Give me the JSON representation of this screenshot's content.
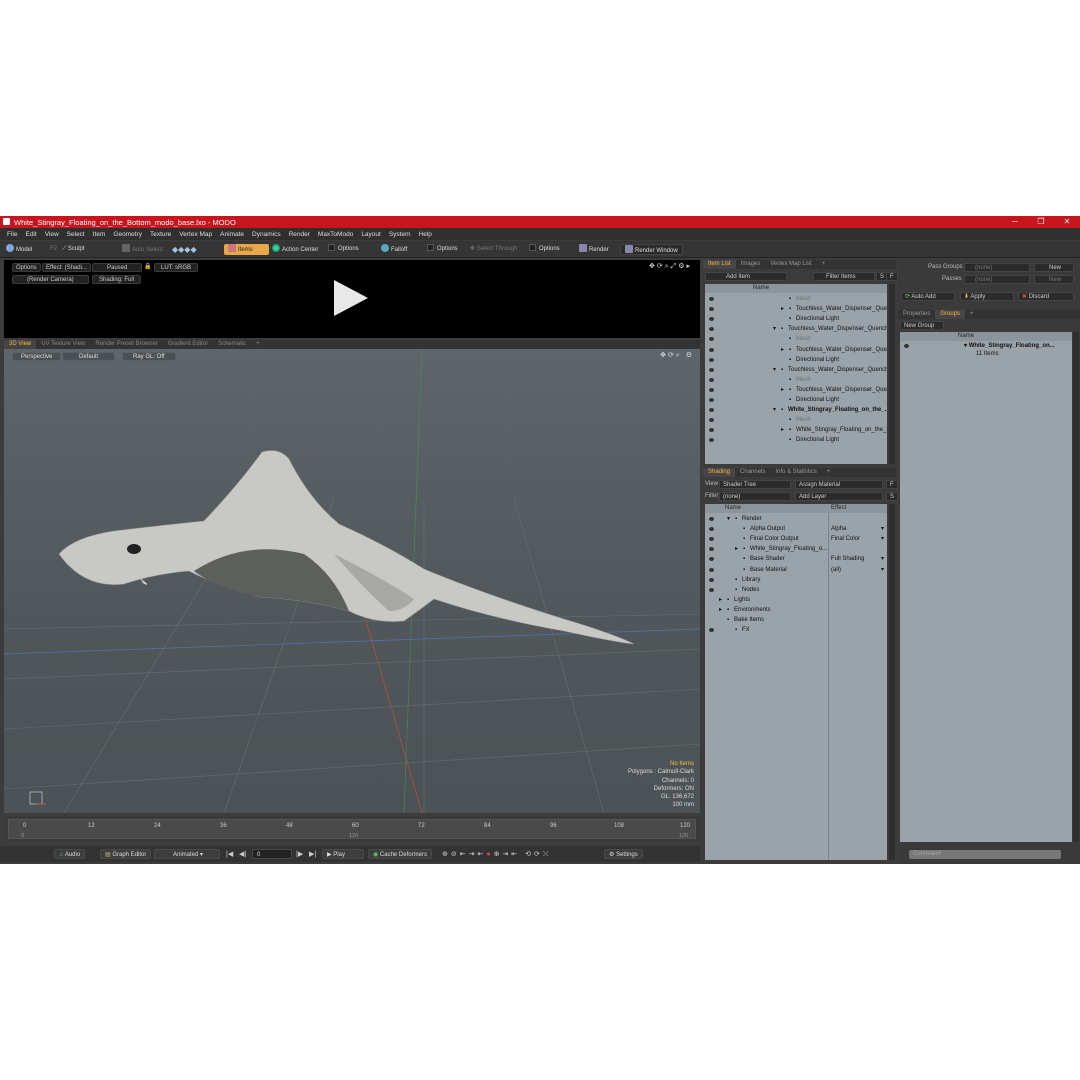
{
  "window": {
    "title": "White_Stingray_Floating_on_the_Bottom_modo_base.lxo - MODO",
    "min": "─",
    "max": "❐",
    "close": "✕"
  },
  "menu": [
    "File",
    "Edit",
    "View",
    "Select",
    "Item",
    "Geometry",
    "Texture",
    "Vertex Map",
    "Animate",
    "Dynamics",
    "Render",
    "MaxToModo",
    "Layout",
    "System",
    "Help"
  ],
  "toolbar": {
    "model": "Model",
    "model_key": "F2",
    "sculpt": "Sculpt",
    "auto_select": "Auto Select",
    "items": "Items",
    "action_center": "Action Center",
    "options1": "Options",
    "falloff": "Falloff",
    "options2": "Options",
    "select_through": "Select Through",
    "options3": "Options",
    "render": "Render",
    "render_window": "Render Window"
  },
  "render_view": {
    "options": "Options",
    "effect": "Effect: (Shadi...",
    "paused": "Paused",
    "lut": "LUT: sRGB",
    "camera": "(Render Camera)",
    "shading": "Shading: Full"
  },
  "viewport_tabs": [
    "3D View",
    "UV Texture View",
    "Render Preset Browser",
    "Gradient Editor",
    "Schematic",
    "+"
  ],
  "viewport": {
    "perspective": "Perspective",
    "default": "Default",
    "ray_gl": "Ray GL: Off"
  },
  "info": {
    "no_items": "No Items",
    "polygons": "Polygons : Catmull-Clark",
    "channels": "Channels: 0",
    "deformers": "Deformers: ON",
    "gl": "GL: 136,672",
    "scale": "100 mm"
  },
  "timeline": {
    "ticks": [
      "0",
      "12",
      "24",
      "36",
      "48",
      "60",
      "72",
      "84",
      "96",
      "108",
      "120"
    ],
    "sub": [
      "0",
      "120",
      "120"
    ]
  },
  "bottombar": {
    "audio": "Audio",
    "graph_editor": "Graph Editor",
    "animated": "Animated",
    "frame": "0",
    "play": "Play",
    "cache": "Cache Deformers",
    "settings": "Settings"
  },
  "item_panel": {
    "tabs": [
      "Item List",
      "Images",
      "Vertex Map List",
      "+"
    ],
    "add_item": "Add Item",
    "filter_items": "Filter Items",
    "s": "S",
    "f": "F",
    "col_name": "Name",
    "rows": [
      {
        "t": "Mesh",
        "lvl": 3,
        "gray": true
      },
      {
        "t": "Touchless_Water_Dispenser_Quench_...",
        "lvl": 3,
        "arrow": "▸"
      },
      {
        "t": "Directional Light",
        "lvl": 3
      },
      {
        "t": "Touchless_Water_Dispenser_Quench_Q8...",
        "lvl": 2,
        "arrow": "▾"
      },
      {
        "t": "Mesh",
        "lvl": 3,
        "gray": true
      },
      {
        "t": "Touchless_Water_Dispenser_Quench_...",
        "lvl": 3,
        "arrow": "▸"
      },
      {
        "t": "Directional Light",
        "lvl": 3
      },
      {
        "t": "Touchless_Water_Dispenser_Quench_Q8...",
        "lvl": 2,
        "arrow": "▾"
      },
      {
        "t": "Mesh",
        "lvl": 3,
        "gray": true
      },
      {
        "t": "Touchless_Water_Dispenser_Quench_...",
        "lvl": 3,
        "arrow": "▸"
      },
      {
        "t": "Directional Light",
        "lvl": 3
      },
      {
        "t": "White_Stingray_Floating_on_the_...",
        "lvl": 2,
        "arrow": "▾",
        "bold": true
      },
      {
        "t": "Mesh",
        "lvl": 3,
        "gray": true
      },
      {
        "t": "White_Stingray_Floating_on_the_Bott...",
        "lvl": 3,
        "arrow": "▸"
      },
      {
        "t": "Directional Light",
        "lvl": 3
      }
    ]
  },
  "shading_panel": {
    "tabs": [
      "Shading",
      "Channels",
      "Info & Statistics",
      "+"
    ],
    "view_label": "View",
    "view_value": "Shader Tree",
    "assign": "Assign Material",
    "filter_label": "Filter",
    "filter_value": "(none)",
    "add_layer": "Add Layer",
    "f": "F",
    "s": "S",
    "col_name": "Name",
    "col_effect": "Effect",
    "rows": [
      {
        "t": "Render",
        "lvl": 1,
        "arrow": "▾",
        "eff": ""
      },
      {
        "t": "Alpha Output",
        "lvl": 2,
        "eff": "Alpha"
      },
      {
        "t": "Final Color Output",
        "lvl": 2,
        "eff": "Final Color"
      },
      {
        "t": "White_Stingray_Floating_o...",
        "lvl": 2,
        "arrow": "▸",
        "eff": ""
      },
      {
        "t": "Base Shader",
        "lvl": 2,
        "eff": "Full Shading"
      },
      {
        "t": "Base Material",
        "lvl": 2,
        "eff": "(all)"
      },
      {
        "t": "Library",
        "lvl": 1,
        "eff": ""
      },
      {
        "t": "Nodes",
        "lvl": 1,
        "eff": ""
      },
      {
        "t": "Lights",
        "lvl": 0,
        "arrow": "▸",
        "eff": ""
      },
      {
        "t": "Environments",
        "lvl": 0,
        "arrow": "▸",
        "eff": ""
      },
      {
        "t": "Bake Items",
        "lvl": 0,
        "eff": ""
      },
      {
        "t": "FX",
        "lvl": 1,
        "eff": ""
      }
    ]
  },
  "right_panel": {
    "pass_groups": "Pass Groups",
    "pass_value": "(none)",
    "new1": "New",
    "passes": "Passes",
    "passes_value": "(none)",
    "new2": "New",
    "auto_add": "Auto Add",
    "apply": "Apply",
    "discard": "Discard",
    "tabs": [
      "Properties",
      "Groups",
      "+"
    ],
    "new_group": "New Group",
    "col_name": "Name",
    "group_name": "White_Stingray_Floating_on...",
    "group_count": "11 Items",
    "command": "Command"
  }
}
